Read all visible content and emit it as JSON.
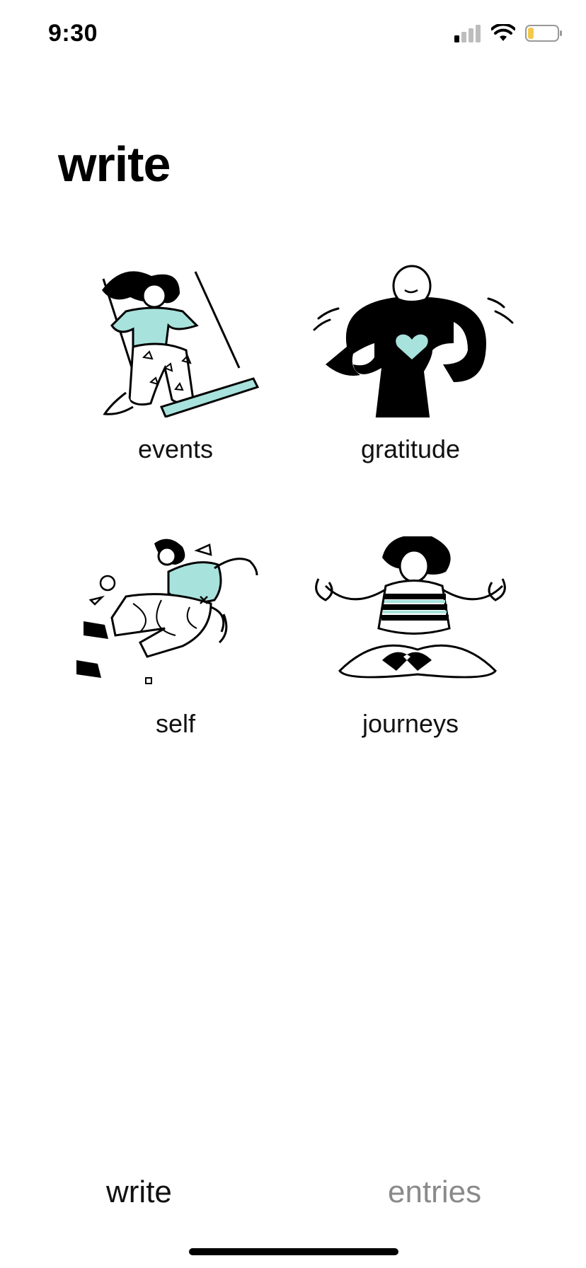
{
  "status_bar": {
    "time": "9:30",
    "signal_icon": "cellular-signal-icon",
    "wifi_icon": "wifi-icon",
    "battery_icon": "battery-low-icon",
    "battery_color": "#f2c94c"
  },
  "page": {
    "title": "write"
  },
  "categories": [
    {
      "label": "events",
      "illustration": "swing-illustration"
    },
    {
      "label": "gratitude",
      "illustration": "heart-hug-illustration"
    },
    {
      "label": "self",
      "illustration": "leap-illustration"
    },
    {
      "label": "journeys",
      "illustration": "meditation-illustration"
    }
  ],
  "tabs": [
    {
      "label": "write",
      "active": true,
      "color": "#111111"
    },
    {
      "label": "entries",
      "active": false,
      "color": "#8a8a8a"
    }
  ],
  "colors": {
    "accent": "#a8e2dc",
    "ink": "#000000"
  }
}
